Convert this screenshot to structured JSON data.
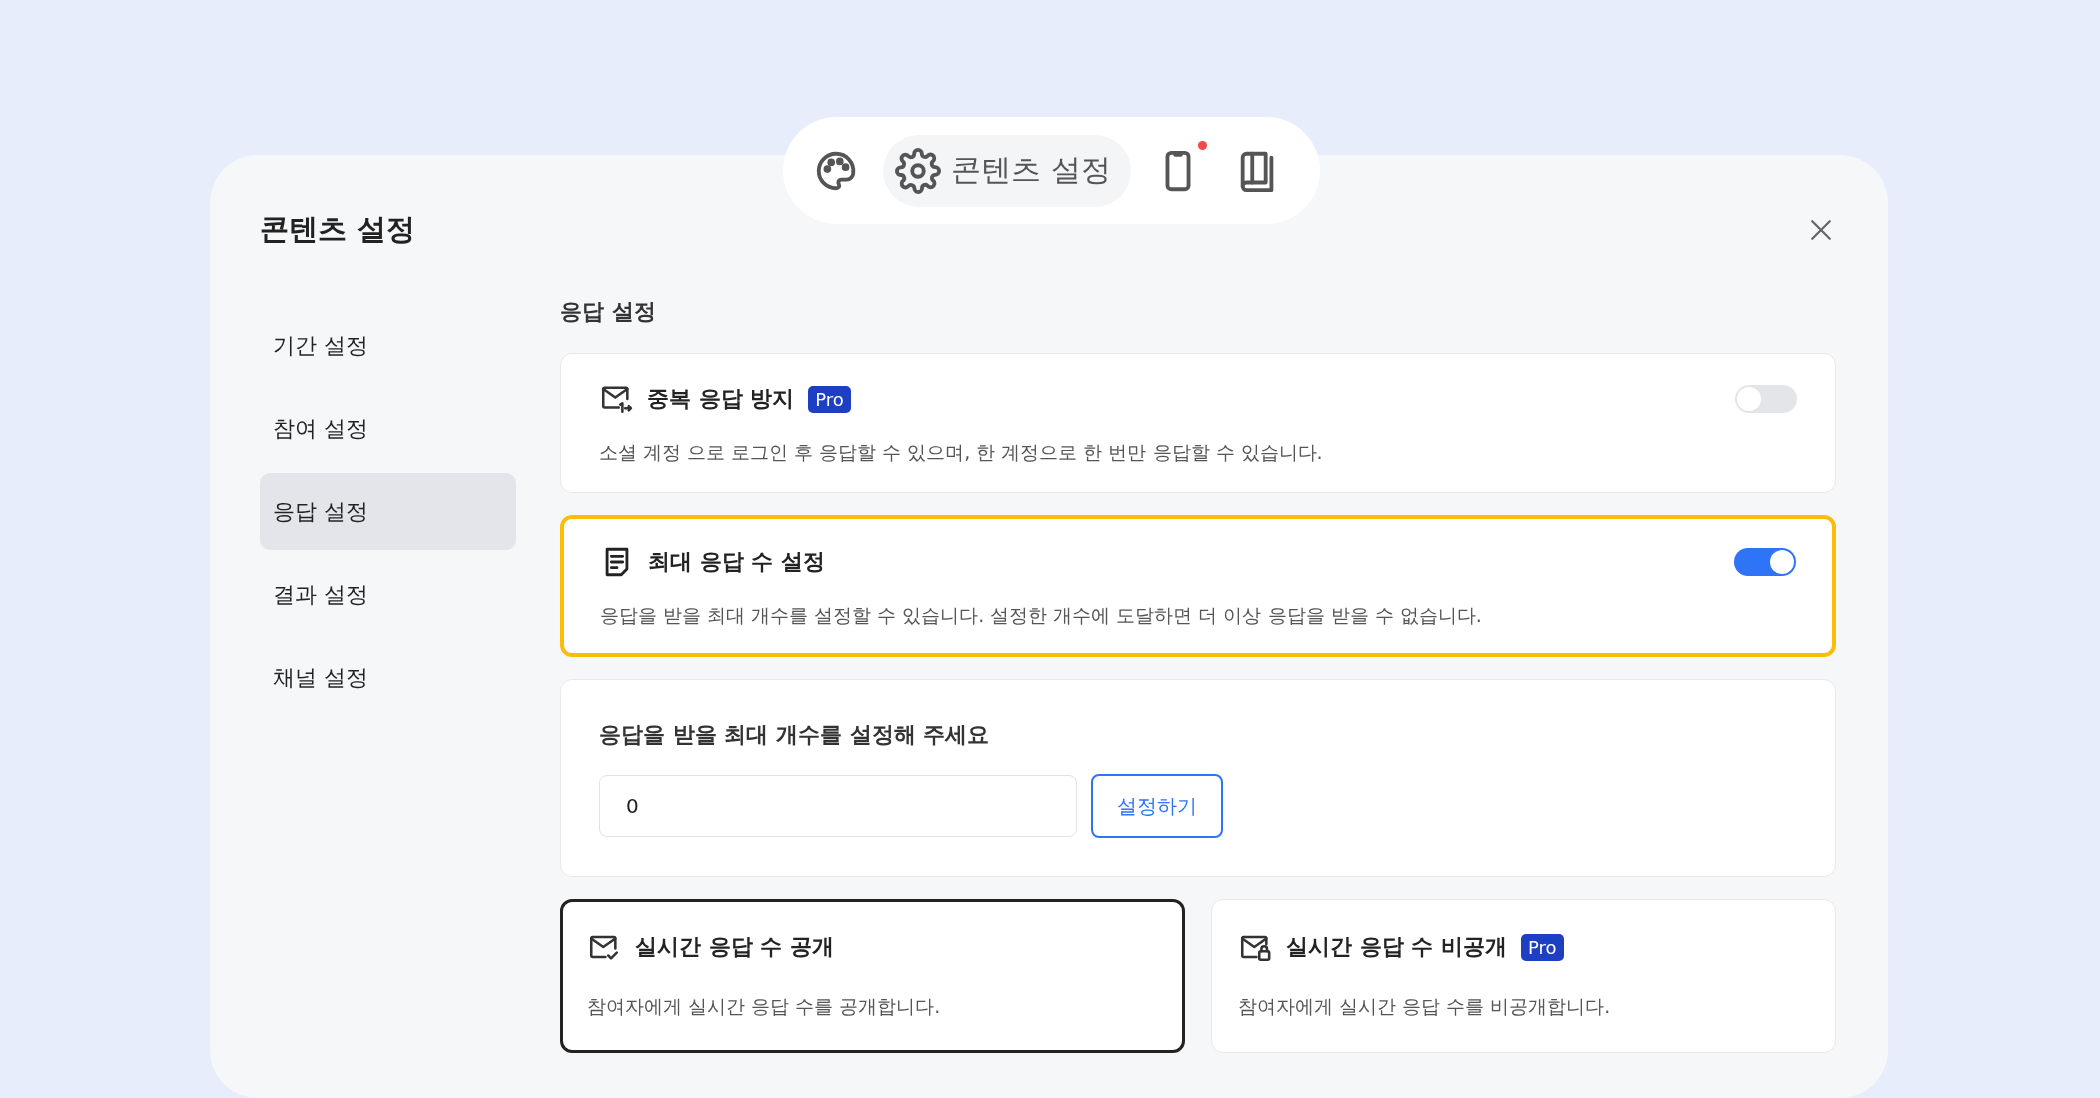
{
  "toolbar": {
    "items": [
      {
        "kind": "palette",
        "selected": false
      },
      {
        "kind": "settings",
        "label": "콘텐츠 설정",
        "selected": true
      },
      {
        "kind": "phone",
        "selected": false,
        "dot": true
      },
      {
        "kind": "book",
        "selected": false
      }
    ]
  },
  "panel": {
    "title": "콘텐츠 설정"
  },
  "sidebar": {
    "items": [
      {
        "label": "기간 설정",
        "selected": false
      },
      {
        "label": "참여 설정",
        "selected": false
      },
      {
        "label": "응답 설정",
        "selected": true
      },
      {
        "label": "결과 설정",
        "selected": false
      },
      {
        "label": "채널 설정",
        "selected": false
      }
    ]
  },
  "section": {
    "title": "응답 설정"
  },
  "settings": [
    {
      "kind": "mail-number",
      "title": "중복 응답 방지",
      "badge": "Pro",
      "description": "소셜 계정 으로 로그인 후 응답할 수 있으며, 한 계정으로 한 번만 응답할 수 있습니다.",
      "on": false,
      "highlighted": false
    },
    {
      "kind": "document",
      "title": "최대 응답 수 설정",
      "description": "응답을 받을 최대 개수를 설정할 수 있습니다. 설정한 개수에 도달하면 더 이상 응답을 받을 수 없습니다.",
      "on": true,
      "highlighted": true
    }
  ],
  "max_responses": {
    "label": "응답을 받을 최대 개수를 설정해 주세요",
    "value": "0",
    "button": "설정하기"
  },
  "visibility_options": [
    {
      "kind": "mail-check",
      "title": "실시간 응답 수 공개",
      "description": "참여자에게 실시간 응답 수를 공개합니다.",
      "selected": true
    },
    {
      "kind": "mail-lock",
      "title": "실시간 응답 수 비공개",
      "badge": "Pro",
      "description": "참여자에게 실시간 응답 수를 비공개합니다.",
      "selected": false
    }
  ]
}
